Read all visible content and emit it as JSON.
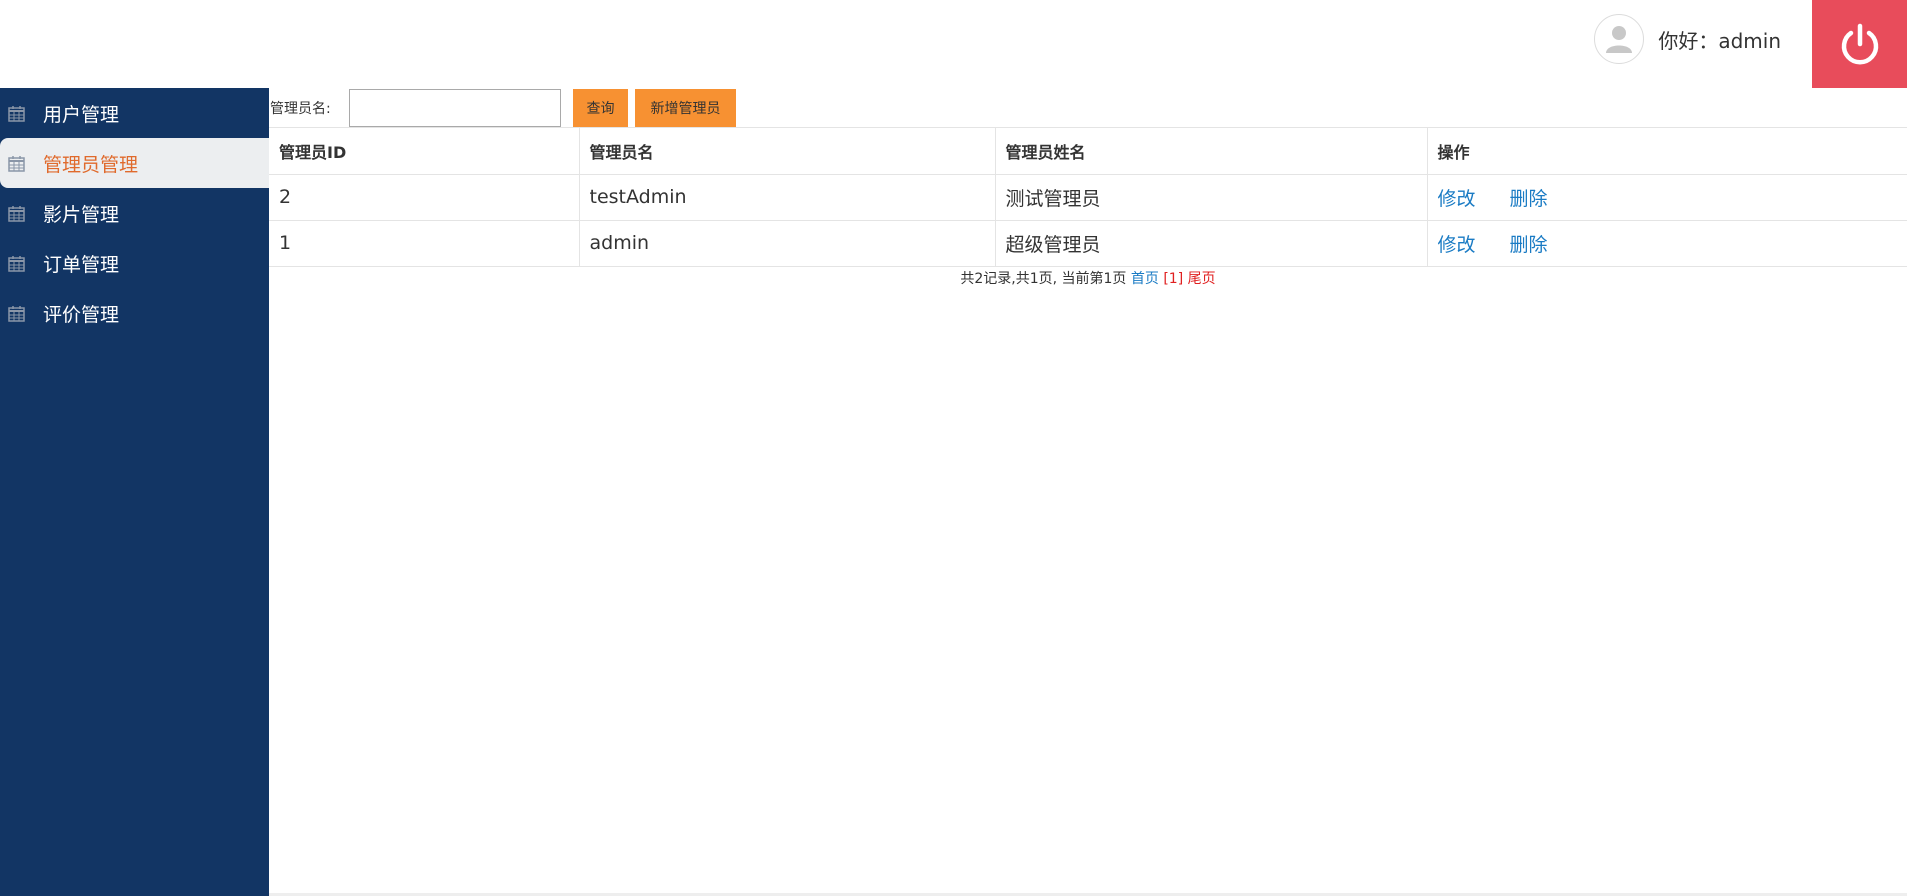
{
  "header": {
    "greeting": "你好：admin",
    "avatar_icon": "user-avatar-icon",
    "logout_icon": "power-icon",
    "logout_color": "#e84c5b"
  },
  "sidebar": {
    "bg_color": "#123564",
    "items": [
      {
        "label": "用户管理",
        "icon": "calendar-icon",
        "active": false
      },
      {
        "label": "管理员管理",
        "icon": "calendar-icon",
        "active": true
      },
      {
        "label": "影片管理",
        "icon": "calendar-icon",
        "active": false
      },
      {
        "label": "订单管理",
        "icon": "calendar-icon",
        "active": false
      },
      {
        "label": "评价管理",
        "icon": "calendar-icon",
        "active": false
      }
    ]
  },
  "search": {
    "label": "管理员名:",
    "value": "",
    "query_label": "查询",
    "add_label": "新增管理员",
    "button_color": "#f79132"
  },
  "table": {
    "headers": [
      "管理员ID",
      "管理员名",
      "管理员姓名",
      "操作"
    ],
    "rows": [
      {
        "id": "2",
        "name": "testAdmin",
        "real_name": "测试管理员",
        "edit": "修改",
        "delete": "删除"
      },
      {
        "id": "1",
        "name": "admin",
        "real_name": "超级管理员",
        "edit": "修改",
        "delete": "删除"
      }
    ]
  },
  "pager": {
    "summary": "共2记录,共1页, 当前第1页",
    "first": "首页",
    "current": "[1]",
    "last": "尾页"
  }
}
